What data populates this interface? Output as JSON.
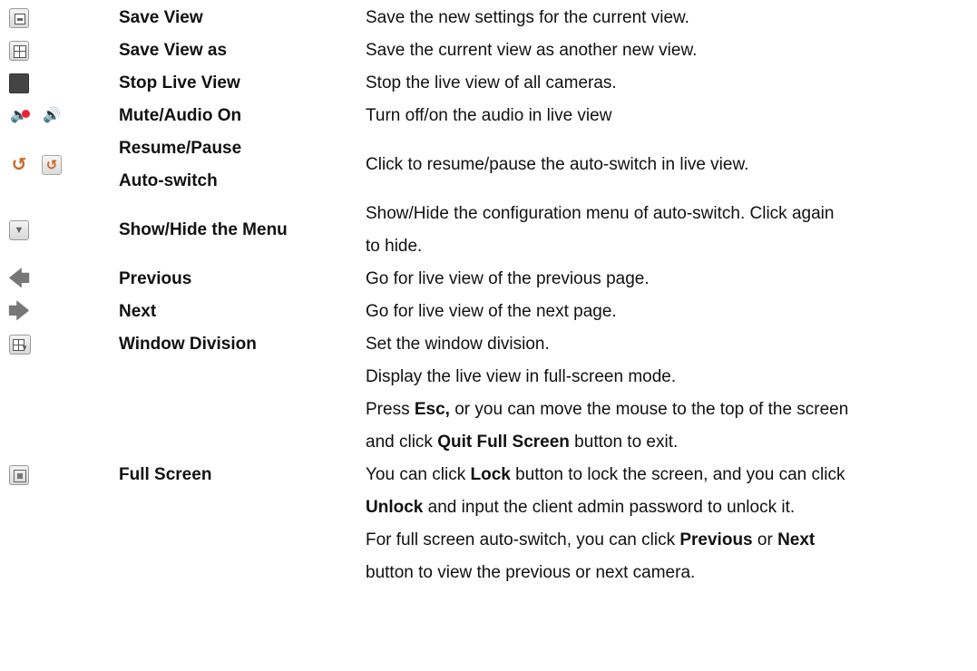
{
  "rows": [
    {
      "name": "Save View",
      "desc": [
        "Save the new settings for the current view."
      ],
      "icons": [
        "save-view-icon"
      ]
    },
    {
      "name": "Save View as",
      "desc": [
        "Save the current view as another new view."
      ],
      "icons": [
        "save-view-as-icon"
      ]
    },
    {
      "name": "Stop Live View",
      "desc": [
        "Stop the live view of all cameras."
      ],
      "icons": [
        "stop-icon"
      ]
    },
    {
      "name": "Mute/Audio On",
      "desc": [
        "Turn off/on the audio in live view"
      ],
      "icons": [
        "mute-icon",
        "audio-on-icon"
      ]
    },
    {
      "name_lines": [
        "Resume/Pause",
        "Auto-switch"
      ],
      "desc": [
        "Click to resume/pause the auto-switch in live view."
      ],
      "icons": [
        "resume-icon",
        "pause-icon"
      ]
    },
    {
      "name": "Show/Hide the Menu",
      "desc": [
        "Show/Hide the configuration menu of auto-switch. Click again",
        "to hide."
      ],
      "icons": [
        "dropdown-icon"
      ]
    },
    {
      "name": "Previous",
      "desc": [
        "Go for live view of the previous page."
      ],
      "icons": [
        "arrow-left-icon"
      ]
    },
    {
      "name": "Next",
      "desc": [
        "Go for live view of the next page."
      ],
      "icons": [
        "arrow-right-icon"
      ]
    },
    {
      "name": "Window Division",
      "desc": [
        "Set the window division."
      ],
      "icons": [
        "window-division-icon"
      ]
    },
    {
      "name": "Full Screen",
      "desc_rich": [
        [
          {
            "t": "Display the live view in full-screen mode."
          }
        ],
        [
          {
            "t": "Press "
          },
          {
            "t": "Esc,",
            "b": true
          },
          {
            "t": " or you can move the mouse to the top of the screen"
          }
        ],
        [
          {
            "t": "and click "
          },
          {
            "t": "Quit Full Screen",
            "b": true
          },
          {
            "t": " button to exit."
          }
        ],
        [
          {
            "t": "You can click "
          },
          {
            "t": "Lock",
            "b": true
          },
          {
            "t": " button to lock the screen, and you can click"
          }
        ],
        [
          {
            "t": "Unlock",
            "b": true
          },
          {
            "t": " and input the client admin password to unlock it."
          }
        ],
        [
          {
            "t": "For full screen auto-switch, you can click "
          },
          {
            "t": "Previous",
            "b": true
          },
          {
            "t": " or "
          },
          {
            "t": "Next",
            "b": true
          }
        ],
        [
          {
            "t": "button to view the previous or next camera."
          }
        ]
      ],
      "icons": [
        "full-screen-icon"
      ]
    }
  ]
}
